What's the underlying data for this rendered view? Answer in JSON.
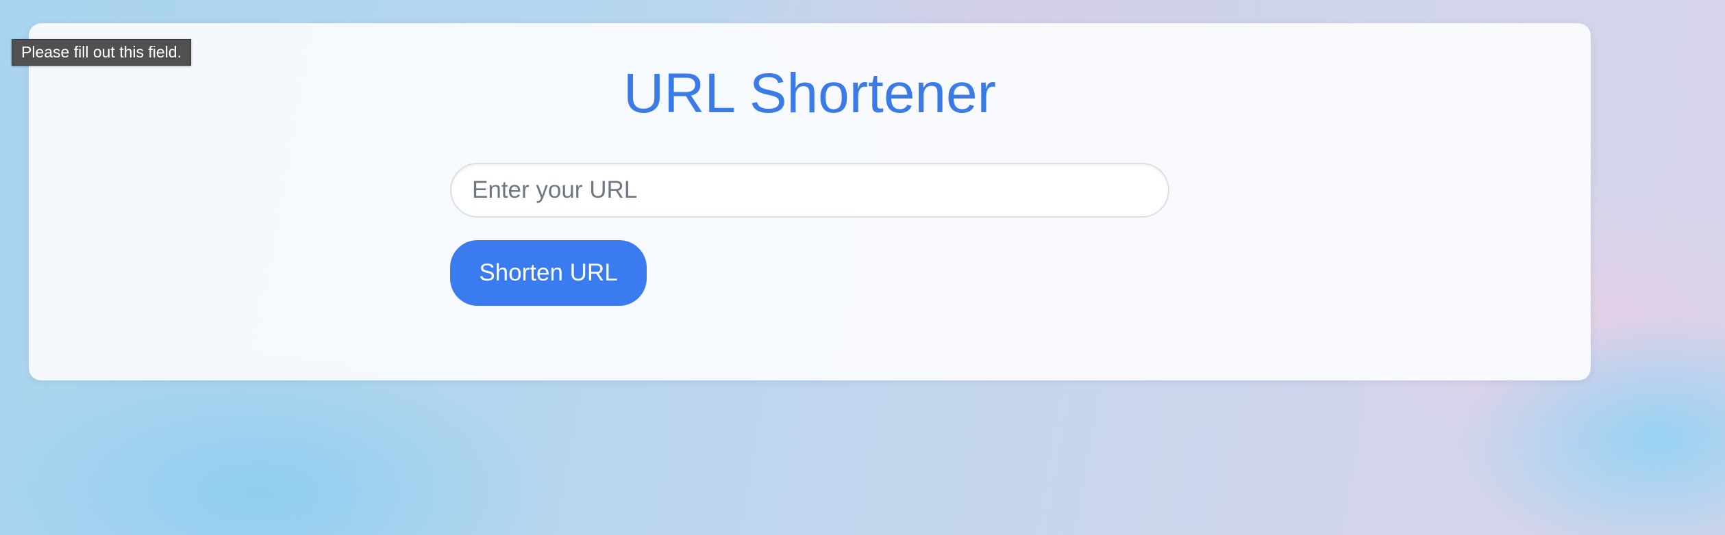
{
  "page": {
    "title": "URL Shortener"
  },
  "form": {
    "url_placeholder": "Enter your URL",
    "url_value": "",
    "submit_label": "Shorten URL"
  },
  "validation_tooltip": {
    "message": "Please fill out this field."
  },
  "colors": {
    "accent": "#3a7bf0",
    "title": "#3b7be8",
    "tooltip_background": "#505050"
  }
}
